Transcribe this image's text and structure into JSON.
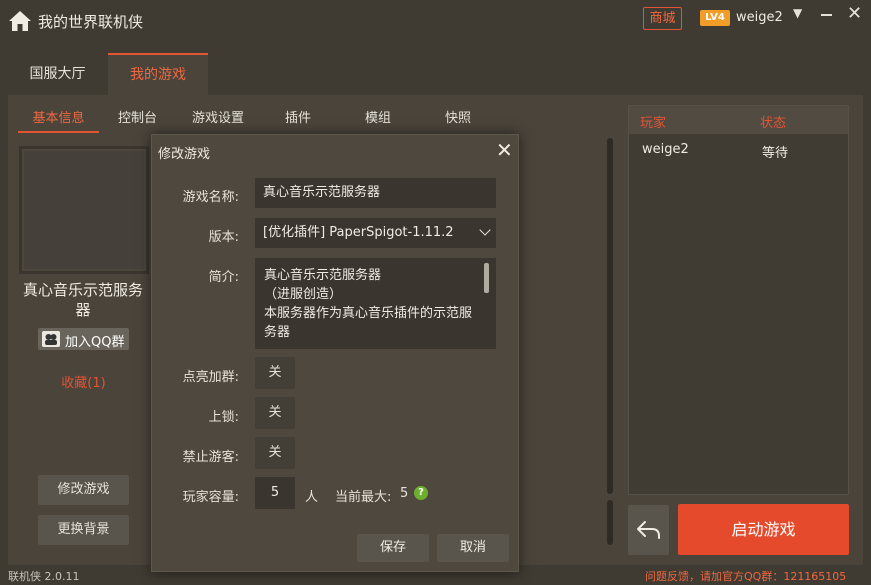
{
  "app": {
    "title": "我的世界联机侠",
    "shop_label": "商城",
    "level_badge": "LV4",
    "username": "weige2"
  },
  "main_tabs": [
    {
      "label": "国服大厅",
      "active": false
    },
    {
      "label": "我的游戏",
      "active": true
    }
  ],
  "sub_tabs": [
    {
      "label": "基本信息",
      "active": true
    },
    {
      "label": "控制台",
      "active": false
    },
    {
      "label": "游戏设置",
      "active": false
    },
    {
      "label": "插件",
      "active": false
    },
    {
      "label": "模组",
      "active": false
    },
    {
      "label": "快照",
      "active": false
    }
  ],
  "left_panel": {
    "server_name": "真心音乐示范服务器",
    "qq_button": "加入QQ群",
    "favorite": "收藏(1)",
    "edit_game": "修改游戏",
    "change_bg": "更换背景"
  },
  "players": {
    "columns": [
      "玩家",
      "状态"
    ],
    "rows": [
      {
        "player": "weige2",
        "status": "等待"
      }
    ]
  },
  "start_button": "启动游戏",
  "status_bar": {
    "version": "联机侠 2.0.11",
    "feedback": "问题反馈，请加官方QQ群：121165105"
  },
  "modal": {
    "title": "修改游戏",
    "fields": {
      "name_label": "游戏名称:",
      "name_value": "真心音乐示范服务器",
      "version_label": "版本:",
      "version_value": "[优化插件] PaperSpigot-1.11.2",
      "intro_label": "简介:",
      "intro_lines": [
        "真心音乐示范服务器",
        "（进服创造）",
        "本服务器作为真心音乐插件的示范服",
        "务器"
      ],
      "lightgroup_label": "点亮加群:",
      "lightgroup_value": "关",
      "lock_label": "上锁:",
      "lock_value": "关",
      "noguest_label": "禁止游客:",
      "noguest_value": "关",
      "capacity_label": "玩家容量:",
      "capacity_value": "5",
      "capacity_unit": "人",
      "current_max_label": "当前最大:",
      "current_max_value": "5"
    },
    "save": "保存",
    "cancel": "取消"
  },
  "colors": {
    "accent": "#e54a2c",
    "background": "#3f3a32",
    "panel": "#4a443b",
    "help_green": "#6cae2e",
    "level_orange": "#f29d28"
  },
  "icons": [
    "home-icon",
    "dropdown-icon",
    "minimize-icon",
    "close-icon",
    "qq-icon",
    "back-icon",
    "help-icon",
    "chevron-down-icon"
  ]
}
